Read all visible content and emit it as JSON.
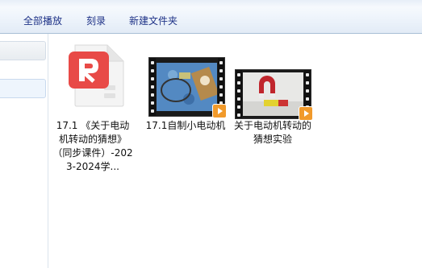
{
  "toolbar": {
    "play_all": "全部播放",
    "burn": "刻录",
    "new_folder": "新建文件夹"
  },
  "files": [
    {
      "label": "17.1 《关于电动机转动的猜想》（同步课件）-2023-2024学...",
      "type": "pdf-icon"
    },
    {
      "label": "17.1自制小电动机",
      "type": "video-thumbnail"
    },
    {
      "label": "关于电动机转动的猜想实验",
      "type": "video-thumbnail"
    }
  ],
  "colors": {
    "toolbar_text": "#1e3287",
    "pdf_accent": "#e84a47",
    "video_badge": "#f19a2b"
  }
}
